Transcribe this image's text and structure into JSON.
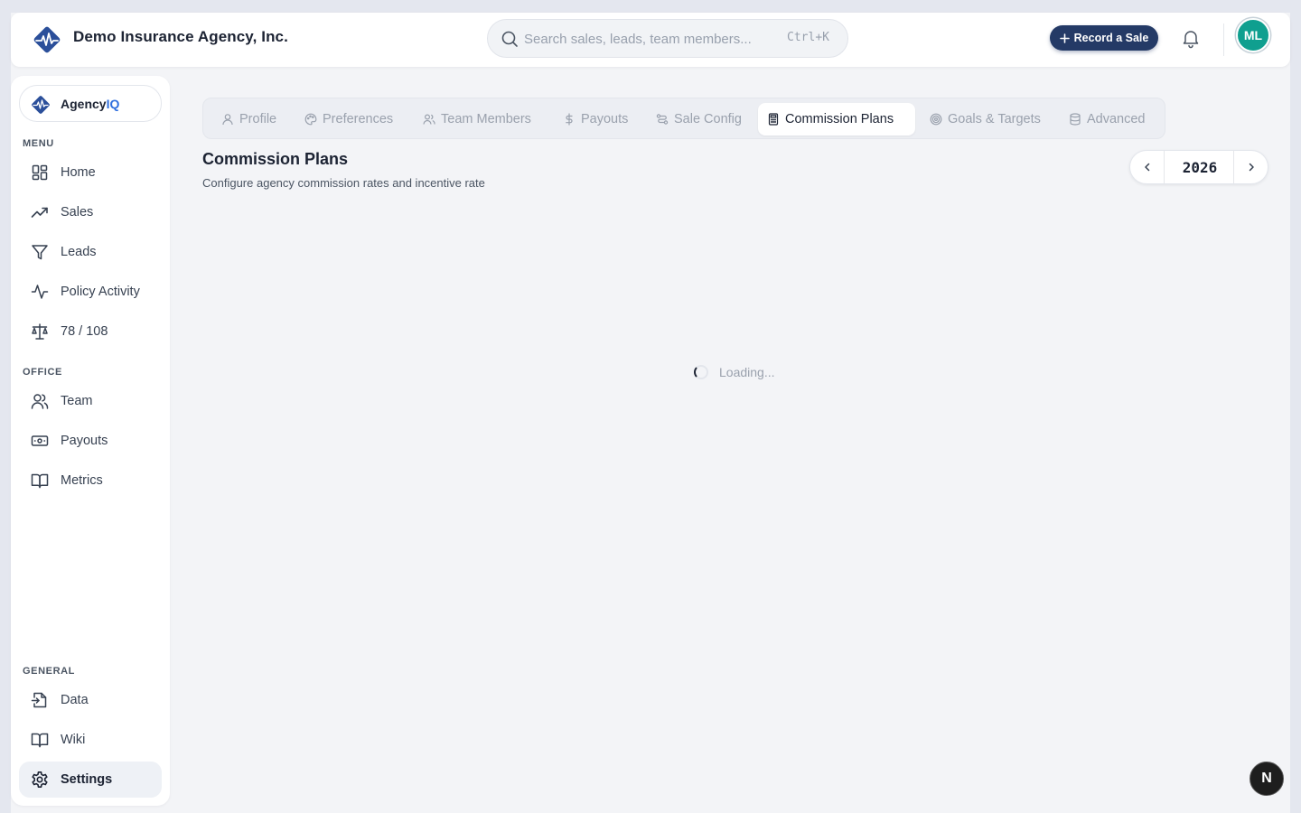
{
  "header": {
    "agency_name": "Demo Insurance Agency, Inc.",
    "search_placeholder": "Search sales, leads, team members...",
    "search_shortcut": "Ctrl+K",
    "record_sale_label": "Record a Sale",
    "avatar_initials": "ML"
  },
  "sidebar": {
    "brand_prefix": "Agency",
    "brand_suffix": "IQ",
    "sections": {
      "menu": "MENU",
      "office": "OFFICE",
      "general": "GENERAL"
    },
    "menu_items": [
      {
        "label": "Home",
        "icon": "grid-icon"
      },
      {
        "label": "Sales",
        "icon": "trending-up-icon"
      },
      {
        "label": "Leads",
        "icon": "funnel-icon"
      },
      {
        "label": "Policy Activity",
        "icon": "activity-icon"
      },
      {
        "label": "78 / 108",
        "icon": "scale-icon"
      }
    ],
    "office_items": [
      {
        "label": "Team",
        "icon": "users-icon"
      },
      {
        "label": "Payouts",
        "icon": "banknote-icon"
      },
      {
        "label": "Metrics",
        "icon": "book-icon"
      }
    ],
    "general_items": [
      {
        "label": "Data",
        "icon": "file-import-icon"
      },
      {
        "label": "Wiki",
        "icon": "book-open-icon"
      },
      {
        "label": "Settings",
        "icon": "gear-icon"
      }
    ]
  },
  "tabs": [
    {
      "label": "Profile",
      "icon": "user-icon"
    },
    {
      "label": "Preferences",
      "icon": "palette-icon"
    },
    {
      "label": "Team Members",
      "icon": "users-icon"
    },
    {
      "label": "Payouts",
      "icon": "dollar-icon"
    },
    {
      "label": "Sale Config",
      "icon": "route-icon"
    },
    {
      "label": "Commission Plans",
      "icon": "calculator-icon",
      "active": true
    },
    {
      "label": "Goals & Targets",
      "icon": "target-icon"
    },
    {
      "label": "Advanced",
      "icon": "database-icon"
    }
  ],
  "main": {
    "title": "Commission Plans",
    "subtitle": "Configure agency commission rates and incentive rate",
    "year": "2026",
    "loading_text": "Loading..."
  },
  "dev_badge": "N",
  "colors": {
    "accent": "#243a66",
    "brand_blue": "#2f6fde",
    "avatar": "#0f9f8f"
  }
}
